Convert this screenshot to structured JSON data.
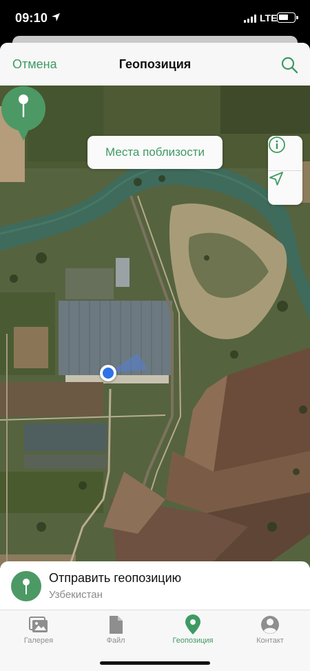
{
  "status_bar": {
    "time": "09:10",
    "network": "LTE"
  },
  "nav": {
    "cancel_label": "Отмена",
    "title": "Геопозиция",
    "search_icon": "search-icon"
  },
  "map": {
    "nearby_label": "Места поблизости",
    "info_icon": "info-icon",
    "locate_icon": "location-arrow-icon",
    "pin_icon": "map-pin-icon"
  },
  "send": {
    "title": "Отправить геопозицию",
    "subtitle": "Узбекистан"
  },
  "tabs": [
    {
      "label": "Галерея",
      "icon": "gallery-icon",
      "active": false
    },
    {
      "label": "Файл",
      "icon": "file-icon",
      "active": false
    },
    {
      "label": "Геопозиция",
      "icon": "location-pin-icon",
      "active": true
    },
    {
      "label": "Контакт",
      "icon": "contact-icon",
      "active": false
    }
  ],
  "colors": {
    "accent": "#3e9a62",
    "user_location": "#2f72e8",
    "pin": "#4c9966"
  }
}
